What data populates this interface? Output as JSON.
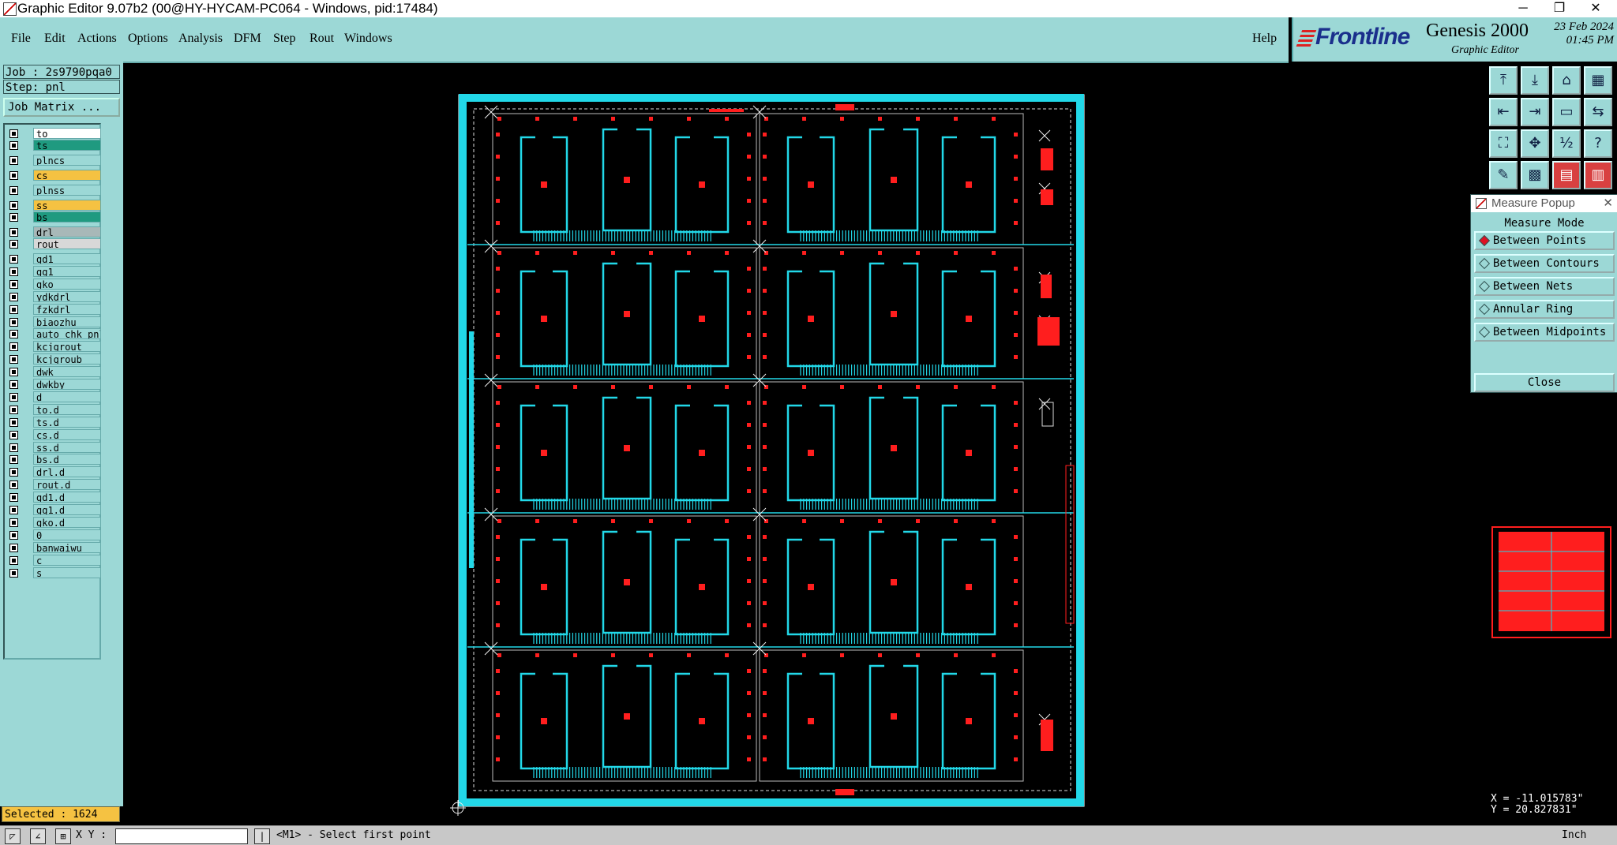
{
  "window": {
    "title": "Graphic Editor 9.07b2 (00@HY-HYCAM-PC064 - Windows, pid:17484)",
    "min": "─",
    "restore": "❐",
    "close": "✕"
  },
  "menu": {
    "file": "File",
    "edit": "Edit",
    "actions": "Actions",
    "options": "Options",
    "analysis": "Analysis",
    "dfm": "DFM",
    "step": "Step",
    "rout": "Rout",
    "windows": "Windows",
    "help": "Help"
  },
  "brand": {
    "logo": "Frontline",
    "product": "Genesis 2000",
    "subtitle": "Graphic Editor",
    "date": "23 Feb 2024",
    "time": "01:45 PM"
  },
  "job": {
    "job_label": "Job : 2s9790pqa0",
    "step_label": "Step: pnl",
    "matrix_button": "Job Matrix ..."
  },
  "layers": [
    {
      "name": "to",
      "color": "#ffffff"
    },
    {
      "name": "ts",
      "color": "#1f9a80"
    },
    {
      "name": "plncs",
      "color": ""
    },
    {
      "name": "cs",
      "color": "#f5c242"
    },
    {
      "name": "plnss",
      "color": ""
    },
    {
      "name": "ss",
      "color": "#f5c242"
    },
    {
      "name": "bs",
      "color": "#1f9a80"
    },
    {
      "name": "drl",
      "color": "#a8b8b8"
    },
    {
      "name": "rout",
      "color": "#d8d8d8"
    },
    {
      "name": "gd1",
      "color": ""
    },
    {
      "name": "gg1",
      "color": ""
    },
    {
      "name": "gko",
      "color": ""
    },
    {
      "name": "ydkdrl",
      "color": ""
    },
    {
      "name": "fzkdrl",
      "color": ""
    },
    {
      "name": "biaozhu",
      "color": ""
    },
    {
      "name": "auto_chk_pnl",
      "color": ""
    },
    {
      "name": "kcjgrout",
      "color": ""
    },
    {
      "name": "kcjgroub",
      "color": ""
    },
    {
      "name": "dwk",
      "color": ""
    },
    {
      "name": "dwkby",
      "color": ""
    },
    {
      "name": "d",
      "color": ""
    },
    {
      "name": "to.d",
      "color": ""
    },
    {
      "name": "ts.d",
      "color": ""
    },
    {
      "name": "cs.d",
      "color": ""
    },
    {
      "name": "ss.d",
      "color": ""
    },
    {
      "name": "bs.d",
      "color": ""
    },
    {
      "name": "drl.d",
      "color": ""
    },
    {
      "name": "rout.d",
      "color": ""
    },
    {
      "name": "gd1.d",
      "color": ""
    },
    {
      "name": "gg1.d",
      "color": ""
    },
    {
      "name": "gko.d",
      "color": ""
    },
    {
      "name": "0",
      "color": ""
    },
    {
      "name": "banwaiwu",
      "color": ""
    },
    {
      "name": "c",
      "color": ""
    },
    {
      "name": "s",
      "color": ""
    }
  ],
  "status": {
    "selected": "Selected : 1624",
    "xy_label": "X Y :",
    "message": "<M1> - Select first point"
  },
  "measure": {
    "title": "Measure Popup",
    "close_x": "✕",
    "mode_heading": "Measure Mode",
    "options": [
      "Between Points",
      "Between Contours",
      "Between Nets",
      "Annular Ring",
      "Between Midpoints"
    ],
    "selected": "Between Points",
    "close_button": "Close"
  },
  "coords": {
    "x": "X = -11.015783\"",
    "y": "Y = 20.827831\"",
    "unit": "Inch"
  },
  "colors": {
    "panel": "#9cd8d6",
    "canvas": "#000000",
    "outline": "#22d8e8",
    "pad": "#ff1e1e"
  },
  "tools": [
    "zoom-in-icon",
    "zoom-out-icon",
    "home-icon",
    "layout-icon",
    "pan-left-icon",
    "pan-right-icon",
    "frame-icon",
    "snap-icon",
    "fit-icon",
    "center-icon",
    "ratio-icon",
    "help-icon",
    "measure-icon",
    "grid-icon",
    "layer-red-icon",
    "layer-red2-icon"
  ]
}
